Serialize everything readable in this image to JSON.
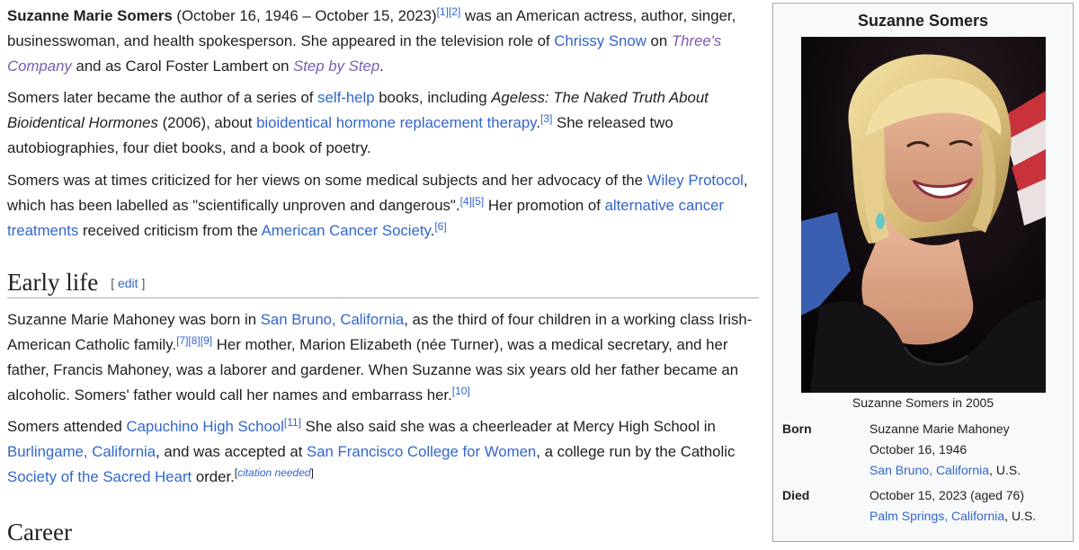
{
  "intro": {
    "p1": {
      "name": "Suzanne Marie Somers",
      "dates": " (October 16, 1946 – October 15, 2023)",
      "ref1": "[1]",
      "ref2": "[2]",
      "text1": " was an American actress, author, singer, businesswoman, and health spokesperson. She appeared in the television role of ",
      "link_chrissy": "Chrissy Snow",
      "text2": " on ",
      "link_threes": "Three's Company",
      "text3": " and as Carol Foster Lambert on ",
      "link_step": "Step by Step",
      "text4": "."
    },
    "p2": {
      "text1": "Somers later became the author of a series of ",
      "link_selfhelp": "self-help",
      "text2": " books, including ",
      "book_title": "Ageless: The Naked Truth About Bioidentical Hormones",
      "text3": " (2006), about ",
      "link_bhrt": "bioidentical hormone replacement therapy",
      "text4": ".",
      "ref3": "[3]",
      "text5": " She released two autobiographies, four diet books, and a book of poetry."
    },
    "p3": {
      "text1": "Somers was at times criticized for her views on some medical subjects and her advocacy of the ",
      "link_wiley": "Wiley Protocol",
      "text2": ", which has been labelled as \"scientifically unproven and dangerous\".",
      "ref4": "[4]",
      "ref5": "[5]",
      "text3": " Her promotion of ",
      "link_alt": "alternative cancer treatments",
      "text4": " received criticism from the ",
      "link_acs": "American Cancer Society",
      "text5": ".",
      "ref6": "[6]"
    }
  },
  "early_life": {
    "heading": "Early life",
    "edit_open": "[ ",
    "edit_label": "edit",
    "edit_close": " ]",
    "p1": {
      "text1": "Suzanne Marie Mahoney was born in ",
      "link_sanbruno": "San Bruno, California",
      "text2": ", as the third of four children in a working class Irish-American Catholic family.",
      "ref7": "[7]",
      "ref8": "[8]",
      "ref9": "[9]",
      "text3": " Her mother, Marion Elizabeth (née Turner), was a medical secretary, and her father, Francis Mahoney, was a laborer and gardener. When Suzanne was six years old her father became an alcoholic. Somers' father would call her names and embarrass her.",
      "ref10": "[10]"
    },
    "p2": {
      "text1": "Somers attended ",
      "link_capuchino": "Capuchino High School",
      "ref11": "[11]",
      "text2": " She also said she was a cheerleader at Mercy High School in ",
      "link_burlingame": "Burlingame, California",
      "text3": ", and was accepted at ",
      "link_sfcw": "San Francisco College for Women",
      "text4": ", a college run by the Catholic ",
      "link_society": "Society of the Sacred Heart",
      "text5": " order.",
      "cn_open": "[",
      "cn_label": "citation needed",
      "cn_close": "]"
    }
  },
  "next_heading": "Career",
  "infobox": {
    "title": "Suzanne Somers",
    "caption": "Suzanne Somers in 2005",
    "born_label": "Born",
    "born_name": "Suzanne Marie Mahoney",
    "born_date": "October 16, 1946",
    "born_place": "San Bruno, California",
    "born_country": ", U.S.",
    "died_label": "Died",
    "died_date": "October 15, 2023 (aged 76)",
    "died_place": "Palm Springs, California",
    "died_country": ", U.S."
  },
  "colors": {
    "link": "#3366cc",
    "visited_link": "#795cb2",
    "text": "#202122",
    "infobox_bg": "#f8f9fa",
    "border": "#a2a9b1"
  }
}
